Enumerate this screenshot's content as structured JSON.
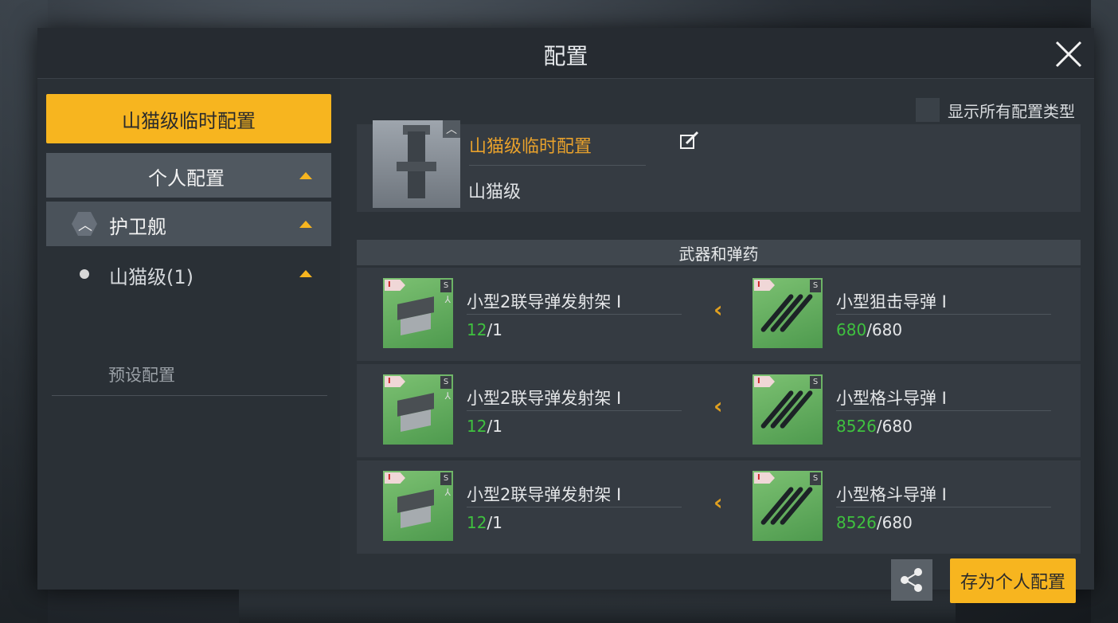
{
  "dialog": {
    "title": "配置"
  },
  "sidebar": {
    "preset_button": "山猫级临时配置",
    "personal_header": "个人配置",
    "category": {
      "icon": "chevron-up-hex-icon",
      "label": "护卫舰"
    },
    "ship_class_item": "山猫级(1)",
    "preset_link": "预设配置"
  },
  "filter": {
    "show_all_label": "显示所有配置类型",
    "checked": false
  },
  "fitting": {
    "name": "山猫级临时配置",
    "ship_class": "山猫级",
    "name_color": "#e8a12c"
  },
  "weapons_section": {
    "title": "武器和弹药",
    "rows": [
      {
        "module": {
          "tier": "I",
          "size": "S",
          "name": "小型2联导弹发射架 I",
          "qty_current": "12",
          "qty_total": "/1",
          "icon": "missile-launcher-icon"
        },
        "ammo": {
          "tier": "I",
          "size": "S",
          "name": "小型狙击导弹 I",
          "qty_current": "680",
          "qty_total": "/680",
          "icon": "missile-ammo-icon"
        }
      },
      {
        "module": {
          "tier": "I",
          "size": "S",
          "name": "小型2联导弹发射架 I",
          "qty_current": "12",
          "qty_total": "/1",
          "icon": "missile-launcher-icon"
        },
        "ammo": {
          "tier": "I",
          "size": "S",
          "name": "小型格斗导弹 I",
          "qty_current": "8526",
          "qty_total": "/680",
          "icon": "missile-ammo-icon"
        }
      },
      {
        "module": {
          "tier": "I",
          "size": "S",
          "name": "小型2联导弹发射架 I",
          "qty_current": "12",
          "qty_total": "/1",
          "icon": "missile-launcher-icon"
        },
        "ammo": {
          "tier": "I",
          "size": "S",
          "name": "小型格斗导弹 I",
          "qty_current": "8526",
          "qty_total": "/680",
          "icon": "missile-ammo-icon"
        }
      }
    ]
  },
  "actions": {
    "save_label": "存为个人配置",
    "share_icon": "share-icon"
  },
  "colors": {
    "accent": "#f7b51f",
    "quantity_green": "#3fc13f",
    "panel": "#2c3238"
  }
}
